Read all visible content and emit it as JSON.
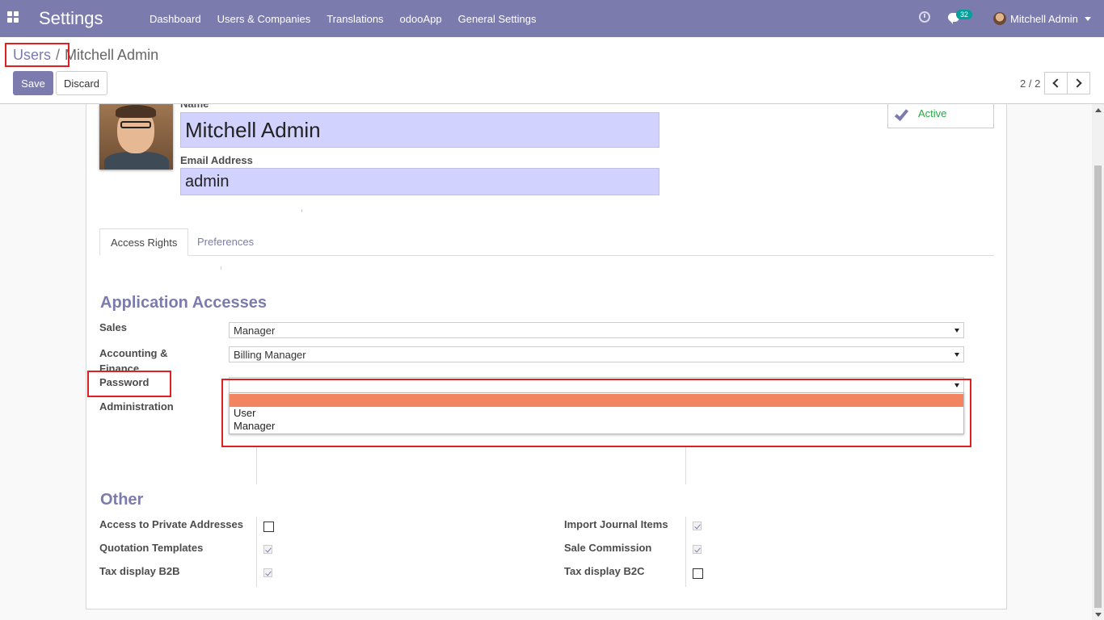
{
  "navbar": {
    "app_title": "Settings",
    "menu": [
      "Dashboard",
      "Users & Companies",
      "Translations",
      "odooApp",
      "General Settings"
    ],
    "message_count": "32",
    "user_name": "Mitchell Admin"
  },
  "breadcrumb": {
    "parent": "Users",
    "separator": "/",
    "current": "Mitchell Admin"
  },
  "toolbar": {
    "save_label": "Save",
    "discard_label": "Discard"
  },
  "pager": {
    "value": "2 / 2"
  },
  "form": {
    "name_label": "Name",
    "name_value": "Mitchell Admin",
    "email_label": "Email Address",
    "email_value": "admin",
    "active_label": "Active"
  },
  "tabs": [
    "Access Rights",
    "Preferences"
  ],
  "application_accesses": {
    "title": "Application Accesses",
    "sales_label": "Sales",
    "sales_value": "Manager",
    "accounting_label": "Accounting & Finance",
    "accounting_value": "Billing Manager",
    "password_label": "Password",
    "password_value": "",
    "password_options": [
      "",
      "User",
      "Manager"
    ],
    "administration_label": "Administration"
  },
  "other": {
    "title": "Other",
    "left": [
      {
        "label": "Access to Private Addresses",
        "checked": false
      },
      {
        "label": "Quotation Templates",
        "checked": true
      },
      {
        "label": "Tax display B2B",
        "checked": true
      }
    ],
    "right": [
      {
        "label": "Import Journal Items",
        "checked": true
      },
      {
        "label": "Sale Commission",
        "checked": true
      },
      {
        "label": "Tax display B2C",
        "checked": false
      }
    ]
  },
  "colors": {
    "brand": "#7c7bad",
    "highlight": "#f28561",
    "active": "#28a745",
    "annotation": "#e02020"
  }
}
